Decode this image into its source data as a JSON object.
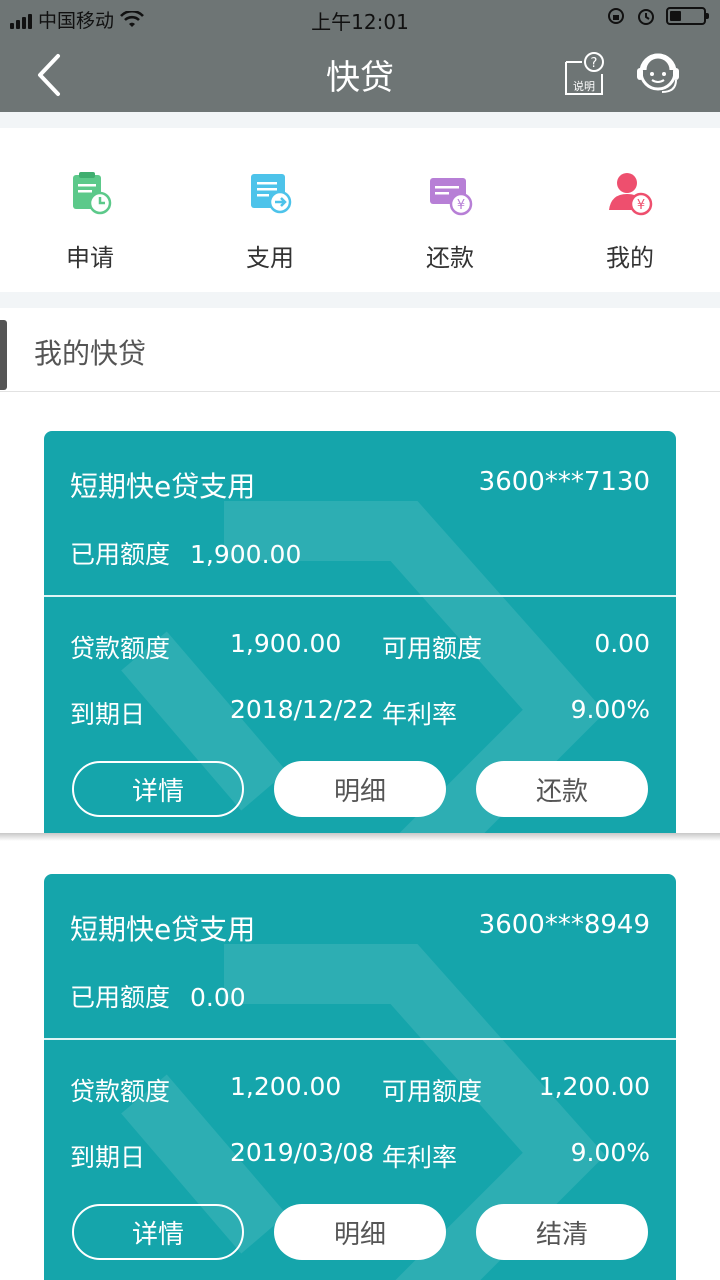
{
  "status_bar": {
    "carrier": "中国移动",
    "time": "上午12:01"
  },
  "nav": {
    "title": "快贷",
    "help_label": "说明"
  },
  "quick_menu": [
    {
      "label": "申请",
      "icon": "clipboard-clock-icon",
      "color": "#5cc98a"
    },
    {
      "label": "支用",
      "icon": "document-arrow-icon",
      "color": "#4dc3ea"
    },
    {
      "label": "还款",
      "icon": "card-yen-icon",
      "color": "#b77fd6"
    },
    {
      "label": "我的",
      "icon": "user-yen-icon",
      "color": "#ee4f6e"
    }
  ],
  "section": {
    "title": "我的快贷"
  },
  "loans": [
    {
      "name": "短期快e贷支用",
      "account": "3600***7130",
      "used_label": "已用额度",
      "used_value": "1,900.00",
      "amount_label": "贷款额度",
      "amount_value": "1,900.00",
      "available_label": "可用额度",
      "available_value": "0.00",
      "due_label": "到期日",
      "due_value": "2018/12/22",
      "rate_label": "年利率",
      "rate_value": "9.00%",
      "btn_detail": "详情",
      "btn_breakdown": "明细",
      "btn_action": "还款"
    },
    {
      "name": "短期快e贷支用",
      "account": "3600***8949",
      "used_label": "已用额度",
      "used_value": "0.00",
      "amount_label": "贷款额度",
      "amount_value": "1,200.00",
      "available_label": "可用额度",
      "available_value": "1,200.00",
      "due_label": "到期日",
      "due_value": "2019/03/08",
      "rate_label": "年利率",
      "rate_value": "9.00%",
      "btn_detail": "详情",
      "btn_breakdown": "明细",
      "btn_action": "结清"
    }
  ],
  "colors": {
    "nav_bg": "#6e7575",
    "card_bg": "#15a5ab"
  }
}
